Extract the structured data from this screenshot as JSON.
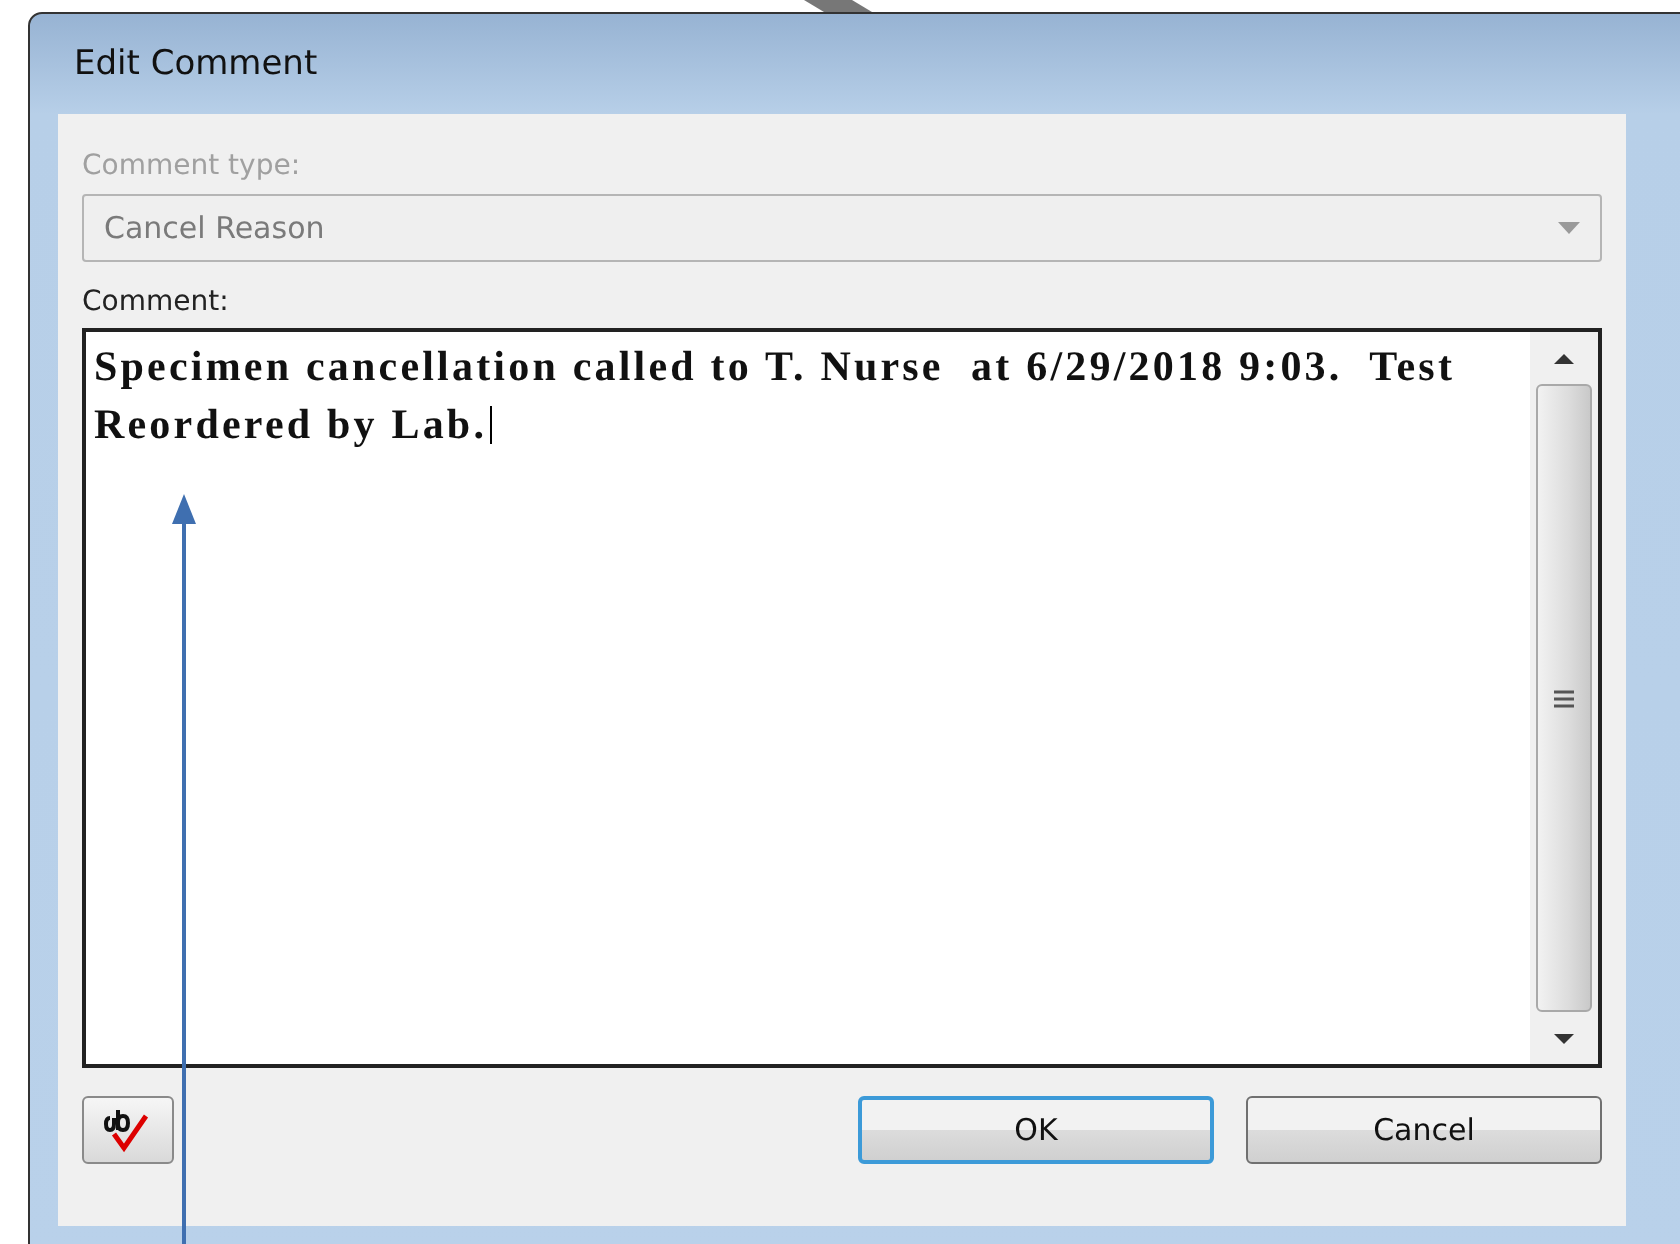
{
  "window": {
    "title": "Edit Comment"
  },
  "comment_type": {
    "label": "Comment type:",
    "value": "Cancel Reason",
    "disabled": true
  },
  "comment": {
    "label": "Comment:",
    "value": "Specimen cancellation called to T. Nurse  at 6/29/2018 9:03.  Test Reordered by Lab."
  },
  "buttons": [
    {
      "label": "OK",
      "kind": "default"
    },
    {
      "label": "Cancel",
      "kind": "normal"
    }
  ]
}
